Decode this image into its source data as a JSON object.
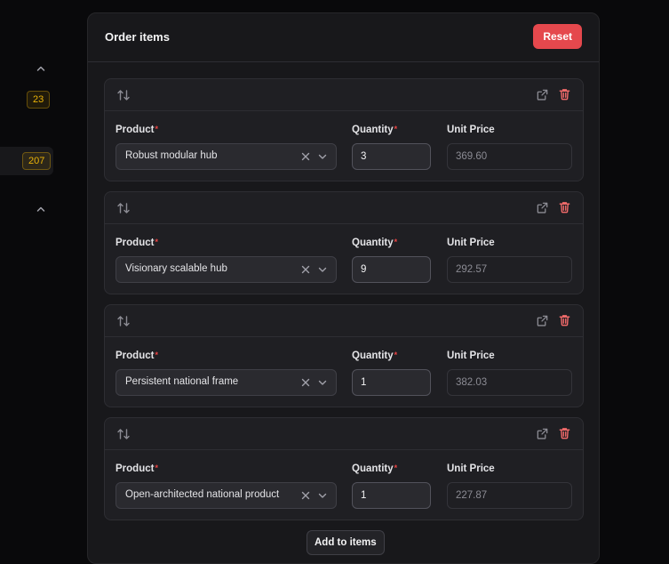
{
  "sidebar": {
    "badges": [
      "23",
      "207"
    ]
  },
  "panel": {
    "title": "Order items",
    "reset_label": "Reset",
    "add_label": "Add to items"
  },
  "labels": {
    "product": "Product",
    "quantity": "Quantity",
    "unit_price": "Unit Price",
    "required_mark": "*"
  },
  "items": [
    {
      "product": "Robust modular hub",
      "quantity": "3",
      "unit_price": "369.60"
    },
    {
      "product": "Visionary scalable hub",
      "quantity": "9",
      "unit_price": "292.57"
    },
    {
      "product": "Persistent national frame",
      "quantity": "1",
      "unit_price": "382.03"
    },
    {
      "product": "Open-architected national product",
      "quantity": "1",
      "unit_price": "227.87"
    }
  ],
  "colors": {
    "accent_danger": "#e5484d",
    "badge_amber": "#eab308",
    "background": "#09090b",
    "panel": "#18181b"
  },
  "icons": {
    "reorder": "arrows-up-down-icon",
    "open": "external-link-icon",
    "delete": "trash-icon",
    "clear": "x-icon",
    "dropdown": "chevron-down-icon"
  }
}
